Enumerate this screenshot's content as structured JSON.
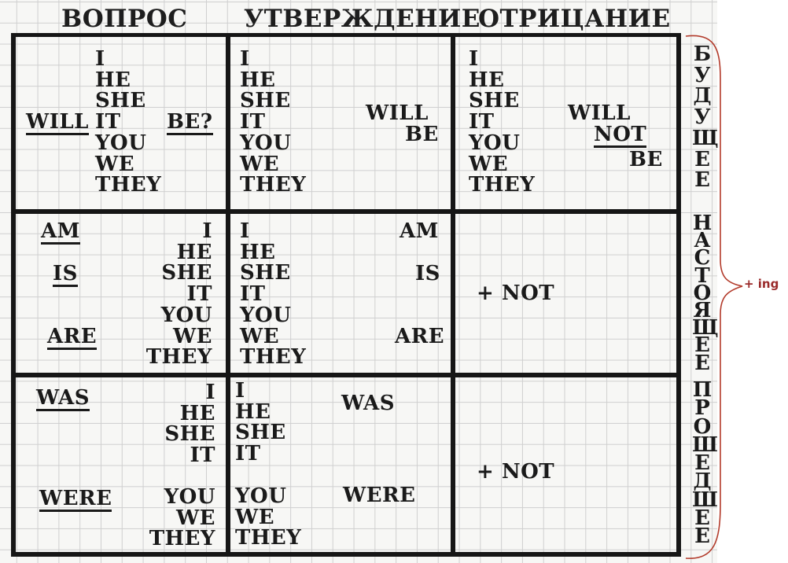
{
  "headers": {
    "question": "ВОПРОС",
    "affirmation": "УТВЕРЖДЕНИЕ",
    "negation": "ОТРИЦАНИЕ"
  },
  "side_labels": {
    "future": [
      "Б",
      "У",
      "Д",
      "У",
      "Щ",
      "Е",
      "Е"
    ],
    "present": [
      "Н",
      "А",
      "С",
      "Т",
      "О",
      "Я",
      "Щ",
      "Е",
      "Е"
    ],
    "past": [
      "П",
      "Р",
      "О",
      "Ш",
      "Е",
      "Д",
      "Ш",
      "Е",
      "Е"
    ]
  },
  "annotation": "+ ing",
  "future": {
    "pronouns": [
      "I",
      "HE",
      "SHE",
      "IT",
      "YOU",
      "WE",
      "THEY"
    ],
    "question_aux": "WILL",
    "question_be": "BE?",
    "affirm_will": "WILL",
    "affirm_be": "BE",
    "neg_will": "WILL",
    "neg_not": "NOT",
    "neg_be": "BE"
  },
  "present": {
    "q_am": "AM",
    "q_is": "IS",
    "q_are": "ARE",
    "pronouns_right": [
      "I",
      "HE",
      "SHE",
      "IT",
      "YOU",
      "WE",
      "THEY"
    ],
    "pronouns_left": [
      "I",
      "HE",
      "SHE",
      "IT",
      "YOU",
      "WE",
      "THEY"
    ],
    "a_am": "AM",
    "a_is": "IS",
    "a_are": "ARE",
    "negation": "+ NOT"
  },
  "past": {
    "q_was": "WAS",
    "q_were": "WERE",
    "pronouns_right_top": [
      "I",
      "HE",
      "SHE",
      "IT"
    ],
    "pronouns_right_bottom": [
      "YOU",
      "WE",
      "THEY"
    ],
    "pronouns_left_top": [
      "I",
      "HE",
      "SHE",
      "IT"
    ],
    "pronouns_left_bottom": [
      "YOU",
      "WE",
      "THEY"
    ],
    "a_was": "WAS",
    "a_were": "WERE",
    "negation": "+ NOT"
  }
}
